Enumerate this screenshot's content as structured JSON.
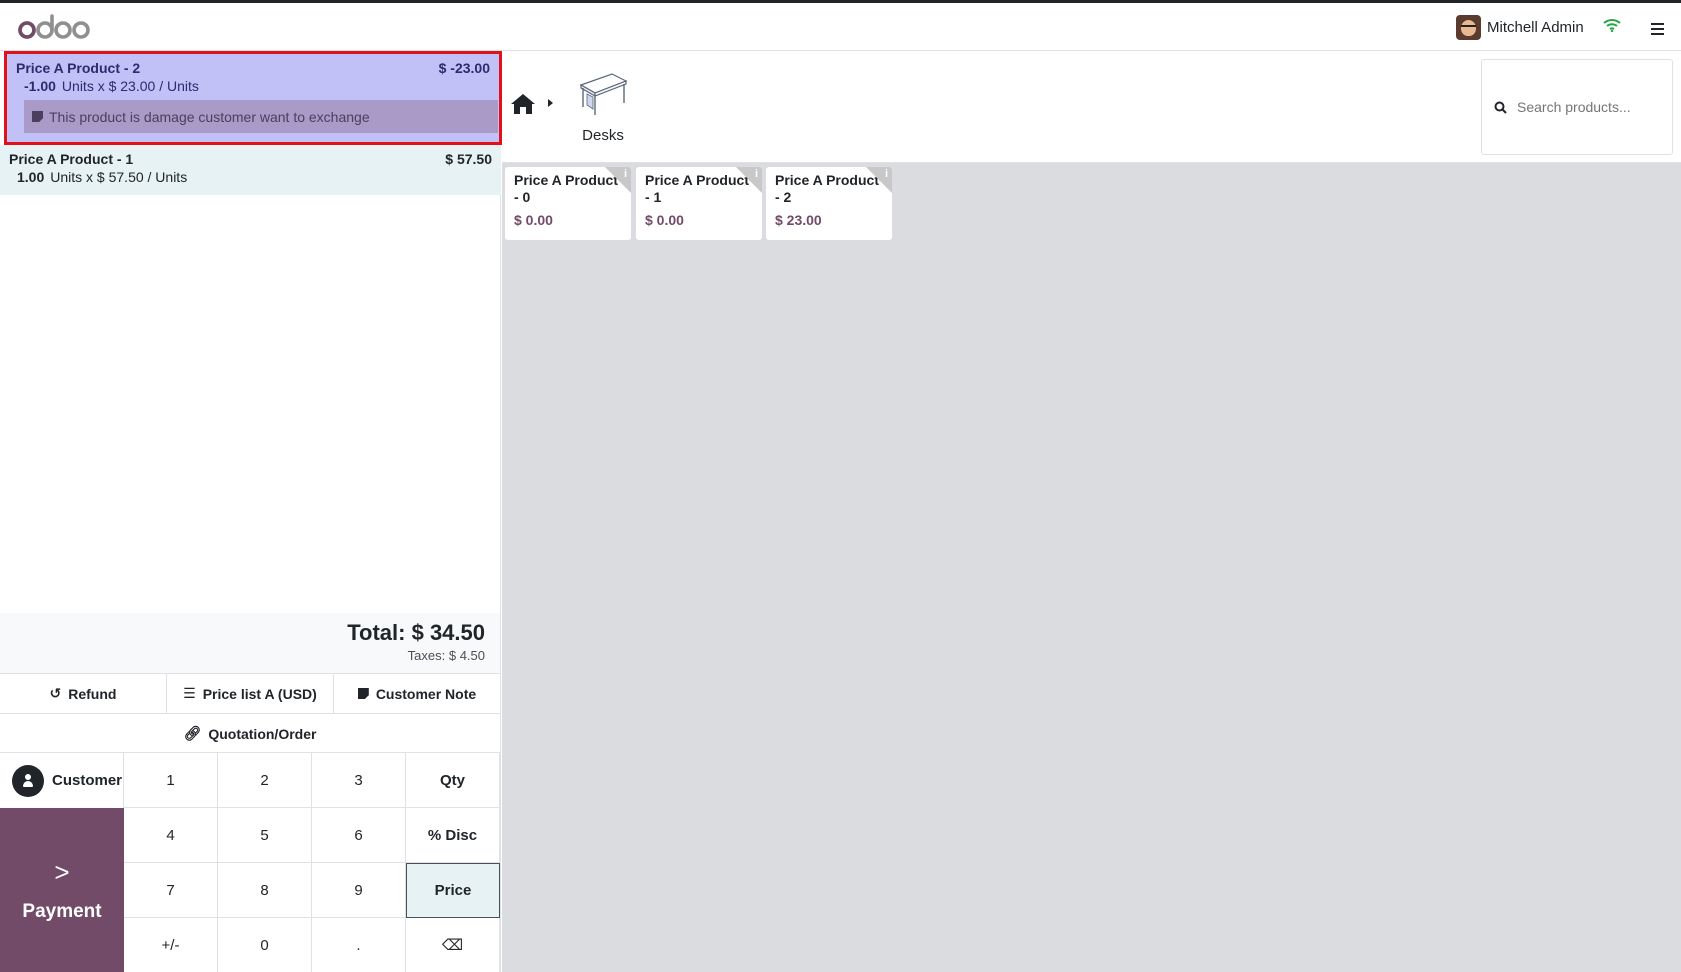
{
  "header": {
    "logo_text": "odoo",
    "user_name": "Mitchell Admin"
  },
  "order": {
    "lines": [
      {
        "name": "Price A Product - 2",
        "price": "$ -23.00",
        "qty": "-1.00",
        "unit_info": "Units x $ 23.00 / Units",
        "note": "This product is damage customer want to exchange"
      },
      {
        "name": "Price A Product - 1",
        "price": "$ 57.50",
        "qty": "1.00",
        "unit_info": "Units x $ 57.50 / Units"
      }
    ],
    "total": "Total: $ 34.50",
    "taxes": "Taxes: $ 4.50"
  },
  "controls": {
    "refund": "Refund",
    "pricelist": "Price list A (USD)",
    "customer_note": "Customer Note",
    "quotation": "Quotation/Order"
  },
  "pad": {
    "customer": "Customer",
    "payment": "Payment",
    "keys": [
      "1",
      "2",
      "3",
      "Qty",
      "4",
      "5",
      "6",
      "% Disc",
      "7",
      "8",
      "9",
      "Price",
      "+/-",
      "0",
      ".",
      "⌫"
    ],
    "active_mode": "Price"
  },
  "categories": {
    "current": "Desks"
  },
  "search": {
    "placeholder": "Search products..."
  },
  "products": [
    {
      "name": "Price A Product - 0",
      "price": "$ 0.00"
    },
    {
      "name": "Price A Product - 1",
      "price": "$ 0.00"
    },
    {
      "name": "Price A Product - 2",
      "price": "$ 23.00"
    }
  ],
  "colors": {
    "brand": "#714b67",
    "selected_line": "#c1c1f8",
    "highlight_border": "#e1111a",
    "wifi": "#28a745"
  }
}
